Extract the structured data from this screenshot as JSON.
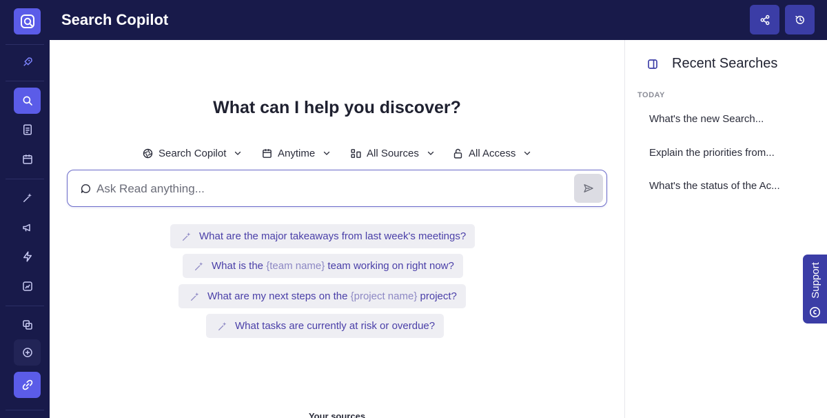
{
  "header": {
    "title": "Search Copilot"
  },
  "main": {
    "headline": "What can I help you discover?",
    "filters": [
      {
        "label": "Search Copilot",
        "icon": "aperture-icon"
      },
      {
        "label": "Anytime",
        "icon": "calendar-icon"
      },
      {
        "label": "All Sources",
        "icon": "sources-icon"
      },
      {
        "label": "All Access",
        "icon": "lock-icon"
      }
    ],
    "search": {
      "placeholder": "Ask Read anything..."
    },
    "suggestions": [
      {
        "pre": "What are the major takeaways from last week's meetings?",
        "ph": "",
        "post": ""
      },
      {
        "pre": "What is the ",
        "ph": "{team name}",
        "post": " team working on right now?"
      },
      {
        "pre": "What are my next steps on the ",
        "ph": "{project name}",
        "post": " project?"
      },
      {
        "pre": "What tasks are currently at risk or overdue?",
        "ph": "",
        "post": ""
      }
    ],
    "sources_label": "Your sources"
  },
  "recent": {
    "title": "Recent Searches",
    "group": "TODAY",
    "items": [
      "What's the new Search...",
      "Explain the priorities from...",
      "What's the status of the Ac..."
    ]
  },
  "support": {
    "label": "Support"
  },
  "colors": {
    "nav": "#181a4a",
    "accent": "#5b5ce8",
    "button": "#3b3da6",
    "suggestion_text": "#4a3fa8"
  }
}
